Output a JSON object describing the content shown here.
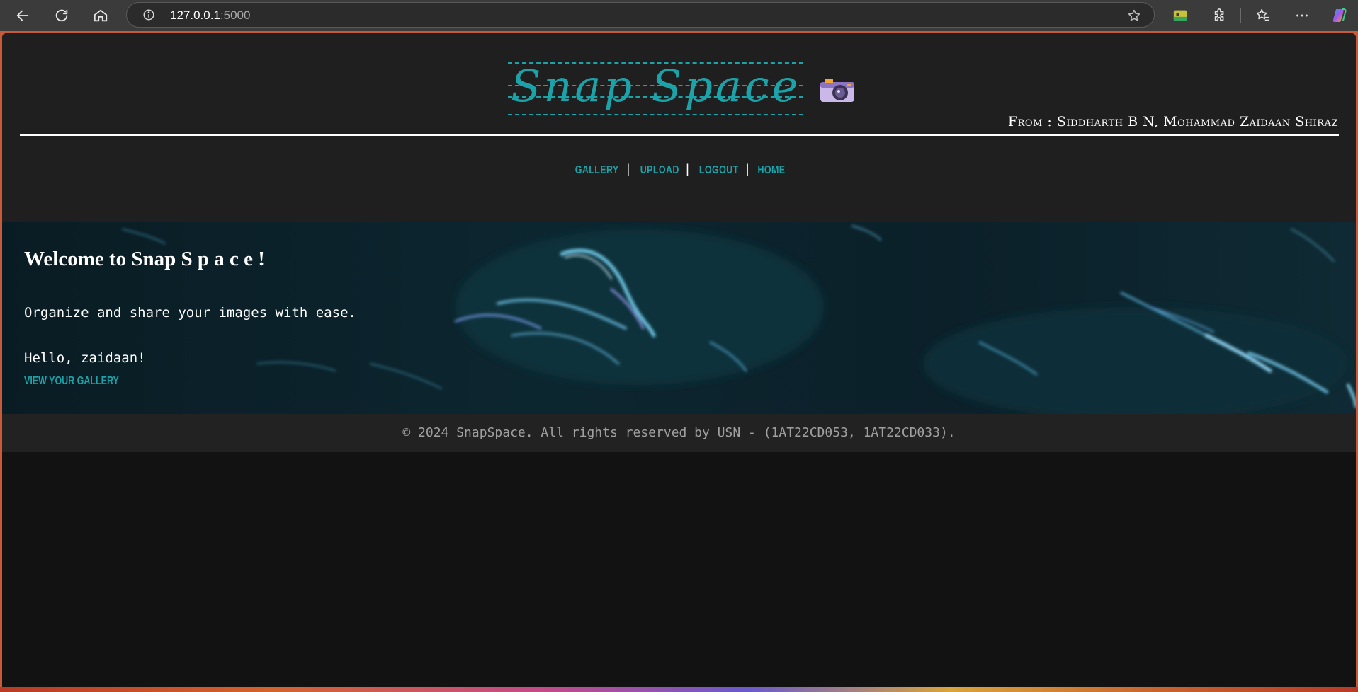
{
  "browser": {
    "url_host": "127.0.0.1",
    "url_port": ":5000",
    "icons": [
      "back-icon",
      "reload-icon",
      "home-icon",
      "info-icon",
      "star-icon",
      "extension-shopping-icon",
      "puzzle-icon",
      "favorites-icon",
      "more-icon",
      "copilot-icon"
    ]
  },
  "header": {
    "logo_text": "Snap Space",
    "logo_icon": "camera-icon",
    "authors": "From : Siddharth B N, Mohammad Zaidaan Shiraz"
  },
  "nav": {
    "items": [
      {
        "label": "Gallery"
      },
      {
        "label": "Upload"
      },
      {
        "label": "Logout"
      },
      {
        "label": "Home"
      }
    ],
    "separator": "|"
  },
  "hero": {
    "title": "Welcome to Snap S p a c e !",
    "subtitle": "Organize and share your images with ease.",
    "greeting": "Hello, zaidaan!",
    "link_label": "View Your Gallery"
  },
  "footer": {
    "text": "© 2024 SnapSpace. All rights reserved by USN - (1AT22CD053, 1AT22CD033)."
  },
  "colors": {
    "accent": "#1ba3a9",
    "header_bg": "#1f1f1f",
    "page_bg": "#121212",
    "footer_bg": "#222222"
  }
}
